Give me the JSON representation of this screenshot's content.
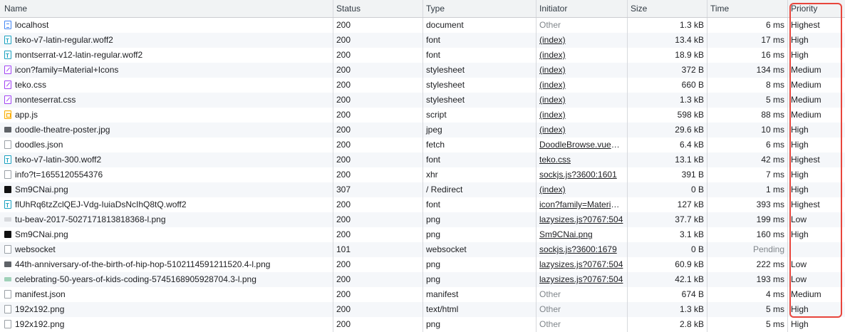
{
  "columns": {
    "name": "Name",
    "status": "Status",
    "type": "Type",
    "initiator": "Initiator",
    "size": "Size",
    "time": "Time",
    "priority": "Priority"
  },
  "rows": [
    {
      "icon": "document-icon",
      "name": "localhost",
      "status": "200",
      "type": "document",
      "initiator": "Other",
      "size": "1.3 kB",
      "time": "6 ms",
      "priority": "Highest"
    },
    {
      "icon": "font-icon",
      "name": "teko-v7-latin-regular.woff2",
      "status": "200",
      "type": "font",
      "initiator": "(index)",
      "size": "13.4 kB",
      "time": "17 ms",
      "priority": "High"
    },
    {
      "icon": "font-icon",
      "name": "montserrat-v12-latin-regular.woff2",
      "status": "200",
      "type": "font",
      "initiator": "(index)",
      "size": "18.9 kB",
      "time": "16 ms",
      "priority": "High"
    },
    {
      "icon": "stylesheet-icon",
      "name": "icon?family=Material+Icons",
      "status": "200",
      "type": "stylesheet",
      "initiator": "(index)",
      "size": "372 B",
      "time": "134 ms",
      "priority": "Medium"
    },
    {
      "icon": "stylesheet-icon",
      "name": "teko.css",
      "status": "200",
      "type": "stylesheet",
      "initiator": "(index)",
      "size": "660 B",
      "time": "8 ms",
      "priority": "Medium"
    },
    {
      "icon": "stylesheet-icon",
      "name": "monteserrat.css",
      "status": "200",
      "type": "stylesheet",
      "initiator": "(index)",
      "size": "1.3 kB",
      "time": "5 ms",
      "priority": "Medium"
    },
    {
      "icon": "script-icon",
      "name": "app.js",
      "status": "200",
      "type": "script",
      "initiator": "(index)",
      "size": "598 kB",
      "time": "88 ms",
      "priority": "Medium"
    },
    {
      "icon": "image-icon",
      "name": "doodle-theatre-poster.jpg",
      "status": "200",
      "type": "jpeg",
      "initiator": "(index)",
      "size": "29.6 kB",
      "time": "10 ms",
      "priority": "High"
    },
    {
      "icon": "blank-file-icon",
      "name": "doodles.json",
      "status": "200",
      "type": "fetch",
      "initiator": "DoodleBrowse.vue?…",
      "size": "6.4 kB",
      "time": "6 ms",
      "priority": "High"
    },
    {
      "icon": "font-icon",
      "name": "teko-v7-latin-300.woff2",
      "status": "200",
      "type": "font",
      "initiator": "teko.css",
      "size": "13.1 kB",
      "time": "42 ms",
      "priority": "Highest"
    },
    {
      "icon": "blank-file-icon",
      "name": "info?t=1655120554376",
      "status": "200",
      "type": "xhr",
      "initiator": "sockjs.js?3600:1601",
      "size": "391 B",
      "time": "7 ms",
      "priority": "High"
    },
    {
      "icon": "image-dark-icon",
      "name": "Sm9CNai.png",
      "status": "307",
      "type": "/ Redirect",
      "initiator": "(index)",
      "size": "0 B",
      "time": "1 ms",
      "priority": "High"
    },
    {
      "icon": "font-icon",
      "name": "flUhRq6tzZclQEJ-Vdg-IuiaDsNcIhQ8tQ.woff2",
      "status": "200",
      "type": "font",
      "initiator": "icon?family=Materia…",
      "size": "127 kB",
      "time": "393 ms",
      "priority": "Highest"
    },
    {
      "icon": "image-light-icon",
      "name": "tu-beav-2017-5027171813818368-l.png",
      "status": "200",
      "type": "png",
      "initiator": "lazysizes.js?0767:504",
      "size": "37.7 kB",
      "time": "199 ms",
      "priority": "Low"
    },
    {
      "icon": "image-dark-icon",
      "name": "Sm9CNai.png",
      "status": "200",
      "type": "png",
      "initiator": "Sm9CNai.png",
      "size": "3.1 kB",
      "time": "160 ms",
      "priority": "High"
    },
    {
      "icon": "blank-file-icon",
      "name": "websocket",
      "status": "101",
      "type": "websocket",
      "initiator": "sockjs.js?3600:1679",
      "size": "0 B",
      "time": "Pending",
      "priority": ""
    },
    {
      "icon": "image-icon",
      "name": "44th-anniversary-of-the-birth-of-hip-hop-5102114591211520.4-l.png",
      "status": "200",
      "type": "png",
      "initiator": "lazysizes.js?0767:504",
      "size": "60.9 kB",
      "time": "222 ms",
      "priority": "Low"
    },
    {
      "icon": "image-mint-icon",
      "name": "celebrating-50-years-of-kids-coding-5745168905928704.3-l.png",
      "status": "200",
      "type": "png",
      "initiator": "lazysizes.js?0767:504",
      "size": "42.1 kB",
      "time": "193 ms",
      "priority": "Low"
    },
    {
      "icon": "blank-file-icon",
      "name": "manifest.json",
      "status": "200",
      "type": "manifest",
      "initiator": "Other",
      "size": "674 B",
      "time": "4 ms",
      "priority": "Medium"
    },
    {
      "icon": "blank-file-icon",
      "name": "192x192.png",
      "status": "200",
      "type": "text/html",
      "initiator": "Other",
      "size": "1.3 kB",
      "time": "5 ms",
      "priority": "High"
    },
    {
      "icon": "blank-file-icon",
      "name": "192x192.png",
      "status": "200",
      "type": "png",
      "initiator": "Other",
      "size": "2.8 kB",
      "time": "5 ms",
      "priority": "High"
    }
  ]
}
